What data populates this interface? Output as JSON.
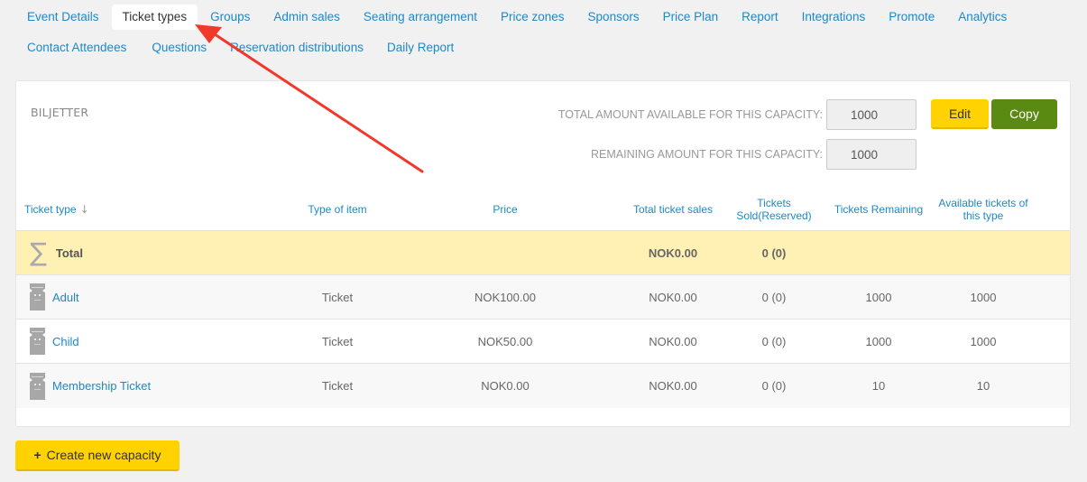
{
  "nav": {
    "row1": [
      {
        "label": "Event Details",
        "active": false
      },
      {
        "label": "Ticket types",
        "active": true
      },
      {
        "label": "Groups",
        "active": false
      },
      {
        "label": "Admin sales",
        "active": false
      },
      {
        "label": "Seating arrangement",
        "active": false
      },
      {
        "label": "Price zones",
        "active": false
      },
      {
        "label": "Sponsors",
        "active": false
      },
      {
        "label": "Price Plan",
        "active": false
      },
      {
        "label": "Report",
        "active": false
      },
      {
        "label": "Integrations",
        "active": false
      },
      {
        "label": "Promote",
        "active": false
      },
      {
        "label": "Analytics",
        "active": false
      }
    ],
    "row2": [
      {
        "label": "Contact Attendees",
        "active": false
      },
      {
        "label": "Questions",
        "active": false
      },
      {
        "label": "Reservation distributions",
        "active": false
      },
      {
        "label": "Daily Report",
        "active": false
      }
    ]
  },
  "card": {
    "title": "BILJETTER",
    "total_label": "TOTAL AMOUNT AVAILABLE FOR THIS CAPACITY:",
    "total_value": "1000",
    "remaining_label": "REMAINING AMOUNT FOR THIS CAPACITY:",
    "remaining_value": "1000",
    "edit_label": "Edit",
    "copy_label": "Copy"
  },
  "table": {
    "headers": {
      "ticket_type": "Ticket type",
      "sort_icon": "↓",
      "type_of_item": "Type of item",
      "price": "Price",
      "total_sales": "Total ticket sales",
      "sold_line1": "Tickets",
      "sold_line2": "Sold(Reserved)",
      "remaining": "Tickets Remaining",
      "available_line1": "Available tickets of",
      "available_line2": "this type"
    },
    "total": {
      "icon": "∑",
      "label": "Total",
      "total_sales": "NOK0.00",
      "sold": "0 (0)"
    },
    "rows": [
      {
        "name": "Adult",
        "type": "Ticket",
        "price": "NOK100.00",
        "total_sales": "NOK0.00",
        "sold": "0 (0)",
        "remaining": "1000",
        "available": "1000"
      },
      {
        "name": "Child",
        "type": "Ticket",
        "price": "NOK50.00",
        "total_sales": "NOK0.00",
        "sold": "0 (0)",
        "remaining": "1000",
        "available": "1000"
      },
      {
        "name": "Membership Ticket",
        "type": "Ticket",
        "price": "NOK0.00",
        "total_sales": "NOK0.00",
        "sold": "0 (0)",
        "remaining": "10",
        "available": "10"
      }
    ]
  },
  "create_button": {
    "icon": "+",
    "label": "Create new capacity"
  },
  "colors": {
    "link": "#1e88c8",
    "edit": "#ffd200",
    "copy": "#5a8a12",
    "total_row": "#fff0b4",
    "annotation_arrow": "#f2382a"
  }
}
